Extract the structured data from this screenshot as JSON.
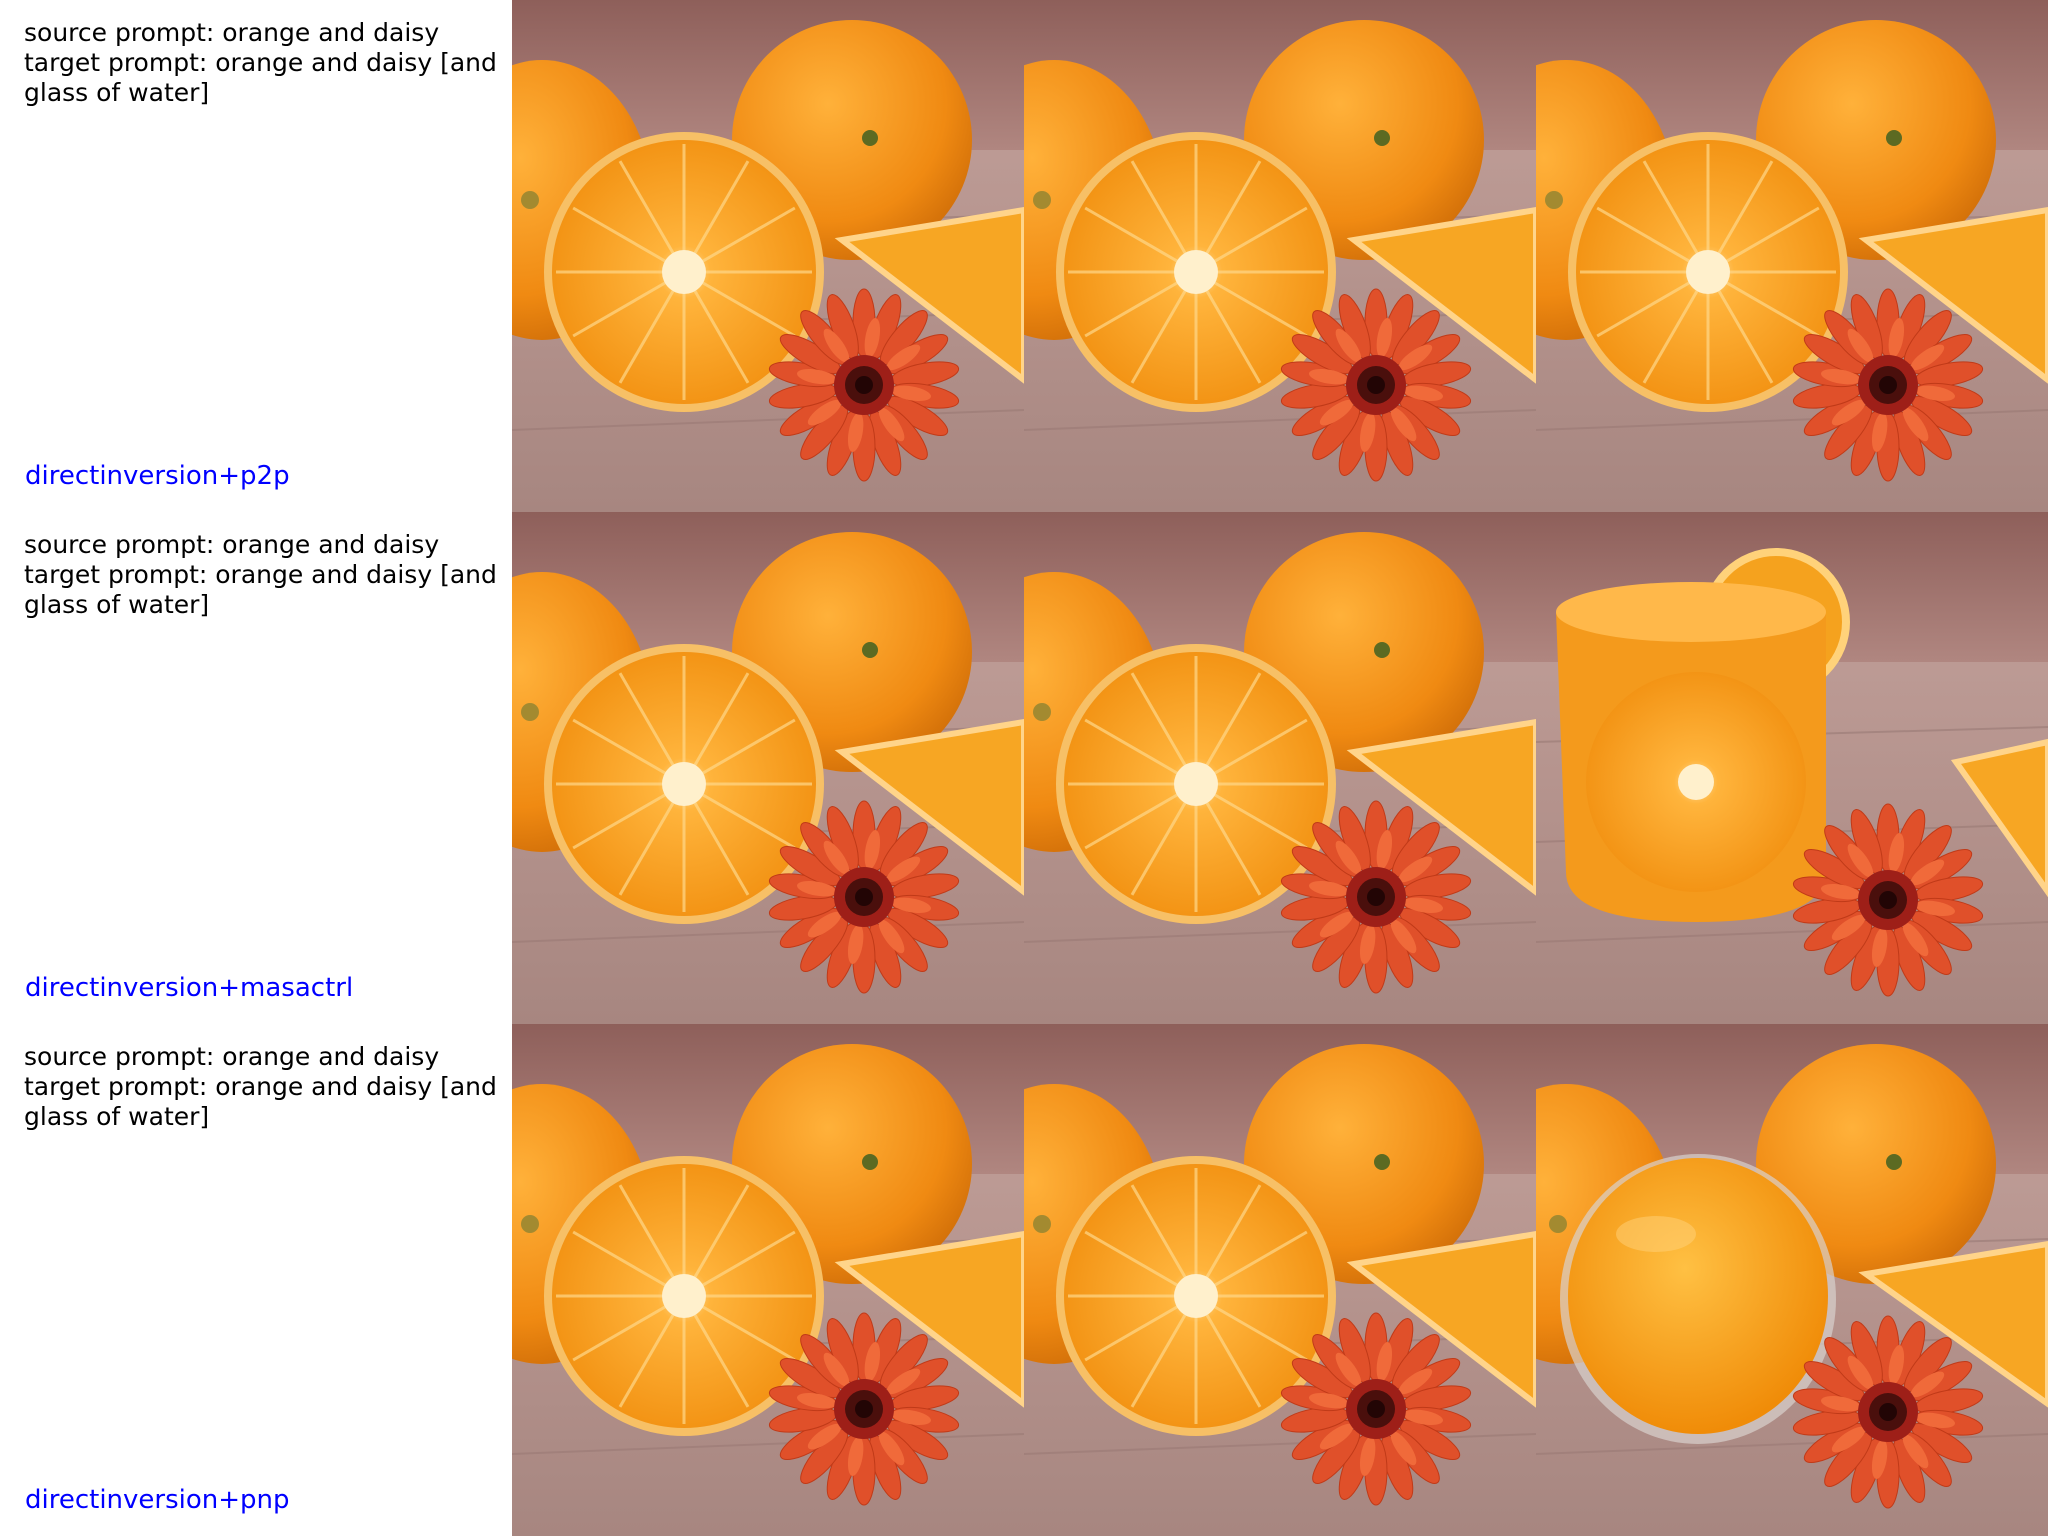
{
  "rows": [
    {
      "source_prompt": "source prompt: orange and daisy",
      "target_prompt": "target prompt: orange and daisy [and glass of water]",
      "method": "directinversion+p2p"
    },
    {
      "source_prompt": "source prompt: orange and daisy",
      "target_prompt": "target prompt: orange and daisy [and glass of water]",
      "method": "directinversion+masactrl"
    },
    {
      "source_prompt": "source prompt: orange and daisy",
      "target_prompt": "target prompt: orange and daisy [and glass of water]",
      "method": "directinversion+pnp"
    }
  ],
  "colors": {
    "method_label": "#0000ff",
    "prompt_text": "#000000",
    "orange_peel": "#f08a12",
    "orange_flesh": "#f7a21e",
    "daisy_petal": "#e2512a",
    "daisy_center": "#3a0d0d",
    "wood": "#b9958f",
    "wall": "#9a6a64",
    "juice": "#f59a0e"
  }
}
